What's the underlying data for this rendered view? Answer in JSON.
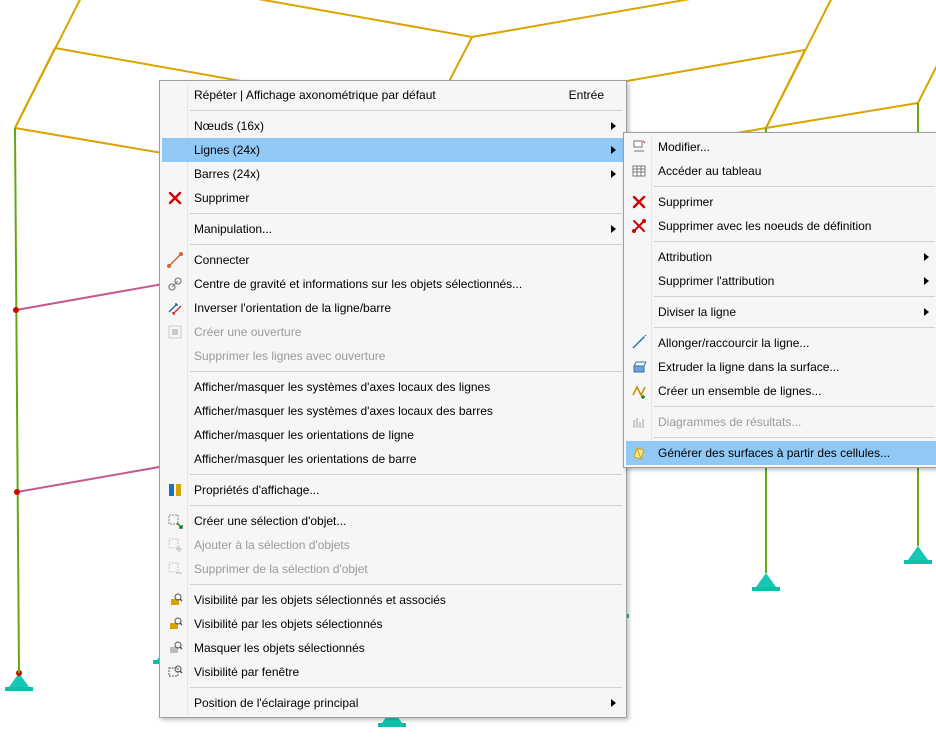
{
  "main_menu": {
    "repeat": {
      "label": "Répéter | Affichage axonométrique par défaut",
      "shortcut": "Entrée"
    },
    "nodes": {
      "label": "Nœuds (16x)"
    },
    "lines": {
      "label": "Lignes (24x)"
    },
    "members": {
      "label": "Barres (24x)"
    },
    "delete": {
      "label": "Supprimer"
    },
    "manipulation": {
      "label": "Manipulation..."
    },
    "connect": {
      "label": "Connecter"
    },
    "center": {
      "label": "Centre de gravité et informations sur les objets sélectionnés..."
    },
    "reverse": {
      "label": "Inverser l'orientation de la ligne/barre"
    },
    "create_open": {
      "label": "Créer une ouverture"
    },
    "delete_open": {
      "label": "Supprimer les lignes avec ouverture"
    },
    "show_l_axes": {
      "label": "Afficher/masquer les systèmes d'axes locaux des lignes"
    },
    "show_m_axes": {
      "label": "Afficher/masquer les systèmes d'axes locaux des barres"
    },
    "show_l_orient": {
      "label": "Afficher/masquer les orientations de ligne"
    },
    "show_m_orient": {
      "label": "Afficher/masquer les orientations de barre"
    },
    "disp_props": {
      "label": "Propriétés d'affichage..."
    },
    "create_sel": {
      "label": "Créer une sélection d'objet..."
    },
    "add_sel": {
      "label": "Ajouter à la sélection d'objets"
    },
    "del_sel": {
      "label": "Supprimer de la sélection d'objet"
    },
    "vis_assoc": {
      "label": "Visibilité par les objets sélectionnés et associés"
    },
    "vis_sel": {
      "label": "Visibilité par les objets sélectionnés"
    },
    "hide_sel": {
      "label": "Masquer les objets sélectionnés"
    },
    "vis_window": {
      "label": "Visibilité par fenêtre"
    },
    "lighting": {
      "label": "Position de l'éclairage principal"
    }
  },
  "sub_menu": {
    "edit": {
      "label": "Modifier..."
    },
    "goto_table": {
      "label": "Accéder au tableau"
    },
    "delete": {
      "label": "Supprimer"
    },
    "delete_def": {
      "label": "Supprimer avec les noeuds de définition"
    },
    "attribution": {
      "label": "Attribution"
    },
    "del_attrib": {
      "label": "Supprimer l'attribution"
    },
    "split": {
      "label": "Diviser la ligne"
    },
    "extend": {
      "label": "Allonger/raccourcir la ligne..."
    },
    "extrude": {
      "label": "Extruder la ligne dans la surface..."
    },
    "set_lines": {
      "label": "Créer un ensemble de lignes..."
    },
    "diagrams": {
      "label": "Diagrammes de résultats..."
    },
    "gen_surf": {
      "label": "Générer des surfaces à partir des cellules..."
    }
  }
}
